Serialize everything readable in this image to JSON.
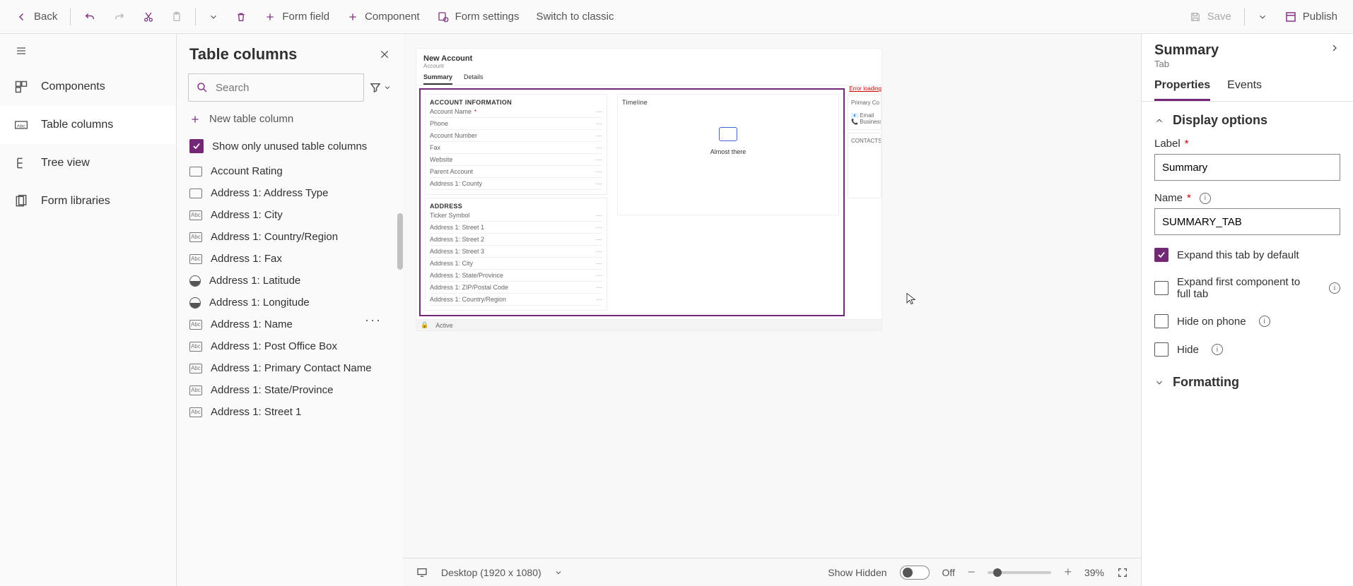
{
  "toolbar": {
    "back": "Back",
    "form_field": "Form field",
    "component": "Component",
    "form_settings": "Form settings",
    "switch": "Switch to classic",
    "save": "Save",
    "publish": "Publish"
  },
  "nav": {
    "components": "Components",
    "table_columns": "Table columns",
    "tree_view": "Tree view",
    "form_libraries": "Form libraries"
  },
  "columns_panel": {
    "title": "Table columns",
    "search_placeholder": "Search",
    "new_column": "New table column",
    "unused_only": "Show only unused table columns",
    "items": [
      "Account Rating",
      "Address 1: Address Type",
      "Address 1: City",
      "Address 1: Country/Region",
      "Address 1: Fax",
      "Address 1: Latitude",
      "Address 1: Longitude",
      "Address 1: Name",
      "Address 1: Post Office Box",
      "Address 1: Primary Contact Name",
      "Address 1: State/Province",
      "Address 1: Street 1"
    ]
  },
  "canvas": {
    "header_title": "New Account",
    "header_sub": "Account",
    "tabs": [
      "Summary",
      "Details"
    ],
    "sections": {
      "account_info_title": "ACCOUNT INFORMATION",
      "account_fields": [
        {
          "label": "Account Name",
          "required": true
        },
        {
          "label": "Phone"
        },
        {
          "label": "Account Number"
        },
        {
          "label": "Fax"
        },
        {
          "label": "Website"
        },
        {
          "label": "Parent Account"
        },
        {
          "label": "Address 1: County"
        }
      ],
      "address_title": "ADDRESS",
      "address_fields": [
        {
          "label": "Ticker Symbol"
        },
        {
          "label": "Address 1: Street 1"
        },
        {
          "label": "Address 1: Street 2"
        },
        {
          "label": "Address 1: Street 3"
        },
        {
          "label": "Address 1: City"
        },
        {
          "label": "Address 1: State/Province"
        },
        {
          "label": "Address 1: ZIP/Postal Code"
        },
        {
          "label": "Address 1: Country/Region"
        }
      ],
      "timeline_title": "Timeline",
      "timeline_msg": "Almost there",
      "error_loading": "Error loading",
      "primary_contact": "Primary Co",
      "email_line": "Email",
      "business_line": "Business",
      "contacts_title": "CONTACTS",
      "status": "Active"
    }
  },
  "statusbar": {
    "device": "Desktop (1920 x 1080)",
    "show_hidden": "Show Hidden",
    "toggle_state": "Off",
    "zoom": "39%"
  },
  "props": {
    "title": "Summary",
    "sub": "Tab",
    "tabs": [
      "Properties",
      "Events"
    ],
    "section_display": "Display options",
    "label_field": "Label",
    "label_value": "Summary",
    "name_field": "Name",
    "name_value": "SUMMARY_TAB",
    "expand_default": "Expand this tab by default",
    "expand_first": "Expand first component to full tab",
    "hide_phone": "Hide on phone",
    "hide": "Hide",
    "section_formatting": "Formatting"
  }
}
